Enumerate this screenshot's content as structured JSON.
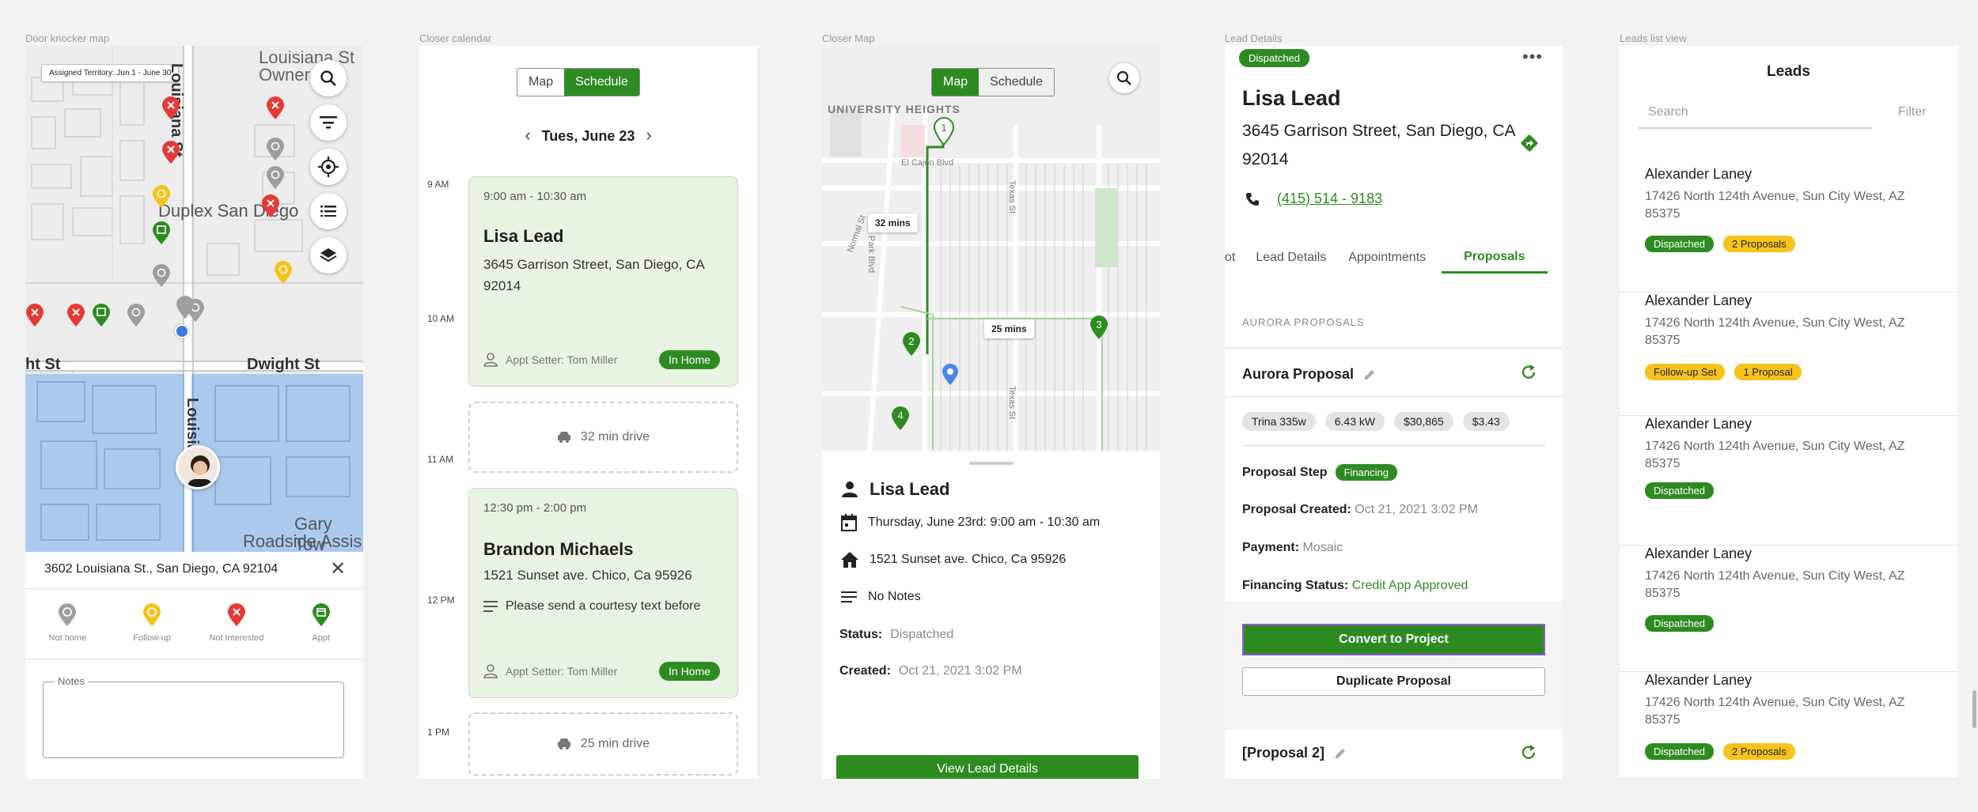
{
  "frames": {
    "door_knocker": "Door knocker map",
    "calendar": "Closer calendar",
    "closer_map": "Closer Map",
    "lead_details": "Lead Details",
    "leads_list": "Leads list view"
  },
  "colors": {
    "brand_green": "#2e8b22",
    "follow_yellow": "#f6c31c",
    "not_interested_red": "#e53935",
    "not_home_gray": "#9e9e9e"
  },
  "door_knocker": {
    "territory": "Assigned Territory: Jun 1 - June 30",
    "map_labels": [
      "Louisiana St",
      "Owners",
      "Duplex San Diego",
      "Dwight St",
      "ht St",
      "Louisiana",
      "Gary Tow",
      "Roadside Assis"
    ],
    "fab_icons": [
      "search-icon",
      "filter-icon",
      "locate-icon",
      "list-icon",
      "layers-icon"
    ],
    "address": "3602 Louisiana St., San Diego, CA 92104",
    "actions": [
      {
        "label": "Not home",
        "icon": "not-home-pin-icon"
      },
      {
        "label": "Follow-up",
        "icon": "follow-up-pin-icon"
      },
      {
        "label": "Not Interested",
        "icon": "not-interested-pin-icon"
      },
      {
        "label": "Appt",
        "icon": "appointment-pin-icon"
      }
    ],
    "notes_label": "Notes"
  },
  "calendar": {
    "toggle": {
      "map": "Map",
      "schedule": "Schedule"
    },
    "date": "Tues, June 23",
    "times": [
      "9 AM",
      "10 AM",
      "11 AM",
      "12 PM",
      "1 PM"
    ],
    "appt1": {
      "time": "9:00 am - 10:30 am",
      "name": "Lisa Lead",
      "address": "3645 Garrison Street, San Diego, CA 92014",
      "setter": "Appt Setter: Tom Miller",
      "status": "In Home"
    },
    "drive1": "32 min drive",
    "appt2": {
      "time": "12:30 pm - 2:00 pm",
      "name": "Brandon Michaels",
      "address": "1521 Sunset ave. Chico, Ca 95926",
      "note": "Please send a courtesy text before",
      "setter": "Appt Setter: Tom Miller",
      "status": "In Home"
    },
    "drive2": "25 min drive"
  },
  "closer_map": {
    "toggle": {
      "map": "Map",
      "schedule": "Schedule"
    },
    "map_labels": {
      "heights": "UNIVERSITY HEIGHTS",
      "el_cajon": "El Cajon Blvd",
      "texas1": "Texas St",
      "texas2": "Texas St",
      "normal": "Normal St",
      "park": "Park Blvd"
    },
    "route_labels": [
      "32 mins",
      "25 mins"
    ],
    "stops": [
      "1",
      "2",
      "3",
      "4"
    ],
    "name": "Lisa Lead",
    "datetime": "Thursday, June 23rd: 9:00 am - 10:30 am",
    "address": "1521 Sunset ave. Chico, Ca 95926",
    "notes": "No Notes",
    "status_label": "Status:",
    "status_value": "Dispatched",
    "created_label": "Created:",
    "created_value": "Oct 21, 2021 3:02 PM",
    "button": "View Lead Details"
  },
  "lead_details": {
    "status": "Dispatched",
    "more": "•••",
    "name": "Lisa Lead",
    "address": "3645 Garrison Street, San Diego, CA 92014",
    "phone": "(415) 514 - 9183",
    "tabs": [
      "ot",
      "Lead Details",
      "Appointments",
      "Proposals"
    ],
    "active_tab": "Proposals",
    "section": "AURORA PROPOSALS",
    "proposal_title": "Aurora Proposal",
    "chips": [
      "Trina 335w",
      "6.43 kW",
      "$30,865",
      "$3.43"
    ],
    "step_label": "Proposal Step",
    "step_value": "Financing",
    "created_label": "Proposal Created:",
    "created_value": "Oct 21, 2021 3:02 PM",
    "payment_label": "Payment:",
    "payment_value": "Mosaic",
    "financing_label": "Financing Status:",
    "financing_value": "Credit App Approved",
    "convert_button": "Convert to Project",
    "duplicate_button": "Duplicate Proposal",
    "proposal2_title": "[Proposal 2]"
  },
  "leads_list": {
    "title": "Leads",
    "search_placeholder": "Search",
    "filter": "Filter",
    "items": [
      {
        "name": "Alexander Laney",
        "address": "17426 North 124th Avenue, Sun City West, AZ 85375",
        "badges": [
          "Dispatched",
          "2 Proposals"
        ]
      },
      {
        "name": "Alexander Laney",
        "address": "17426 North 124th Avenue, Sun City West, AZ 85375",
        "badges": [
          "Follow-up Set",
          "1 Proposal"
        ]
      },
      {
        "name": "Alexander Laney",
        "address": "17426 North 124th Avenue, Sun City West, AZ 85375",
        "badges": [
          "Dispatched"
        ]
      },
      {
        "name": "Alexander Laney",
        "address": "17426 North 124th Avenue, Sun City West, AZ 85375",
        "badges": [
          "Dispatched"
        ]
      },
      {
        "name": "Alexander Laney",
        "address": "17426 North 124th Avenue, Sun City West, AZ 85375",
        "badges": [
          "Dispatched",
          "2 Proposals"
        ]
      }
    ]
  }
}
